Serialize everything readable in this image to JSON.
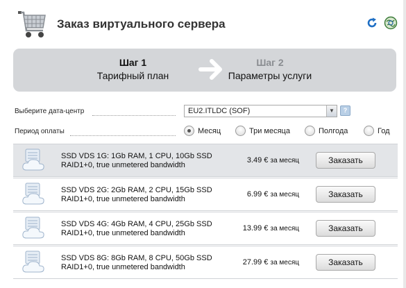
{
  "header": {
    "title": "Заказ виртуального сервера",
    "icons": [
      "shopping-cart-icon",
      "refresh-icon",
      "globe-icon"
    ]
  },
  "wizard": {
    "steps": [
      {
        "title": "Шаг 1",
        "subtitle": "Тарифный план",
        "state": "active"
      },
      {
        "title": "Шаг 2",
        "subtitle": "Параметры услуги",
        "state": "inactive"
      }
    ]
  },
  "form": {
    "datacenter_label": "Выберите дата-центр",
    "datacenter_value": "EU2.ITLDC (SOF)",
    "help_label": "?",
    "period_label": "Период оплаты",
    "period_options": [
      {
        "label": "Месяц",
        "checked": true
      },
      {
        "label": "Три месяца",
        "checked": false
      },
      {
        "label": "Полгода",
        "checked": false
      },
      {
        "label": "Год",
        "checked": false
      }
    ]
  },
  "plans": [
    {
      "line1": "SSD VDS 1G: 1Gb RAM, 1 CPU, 10Gb SSD",
      "line2": "RAID1+0, true unmetered bandwidth",
      "price": "3.49 €",
      "period": "за месяц",
      "button": "Заказать",
      "selected": true
    },
    {
      "line1": "SSD VDS 2G: 2Gb RAM, 2 CPU, 15Gb SSD",
      "line2": "RAID1+0, true unmetered bandwidth",
      "price": "6.99 €",
      "period": "за месяц",
      "button": "Заказать",
      "selected": false
    },
    {
      "line1": "SSD VDS 4G: 4Gb RAM, 4 CPU, 25Gb SSD",
      "line2": "RAID1+0, true unmetered bandwidth",
      "price": "13.99 €",
      "period": "за месяц",
      "button": "Заказать",
      "selected": false
    },
    {
      "line1": "SSD VDS 8G: 8Gb RAM, 8 CPU, 50Gb SSD",
      "line2": "RAID1+0, true unmetered bandwidth",
      "price": "27.99 €",
      "period": "за месяц",
      "button": "Заказать",
      "selected": false
    }
  ],
  "colors": {
    "wizard_bg": "#d4d6d9",
    "selected_row_bg": "#e3e5e8",
    "inactive_step": "#8a8d91",
    "refresh_blue": "#1f6fc4"
  }
}
